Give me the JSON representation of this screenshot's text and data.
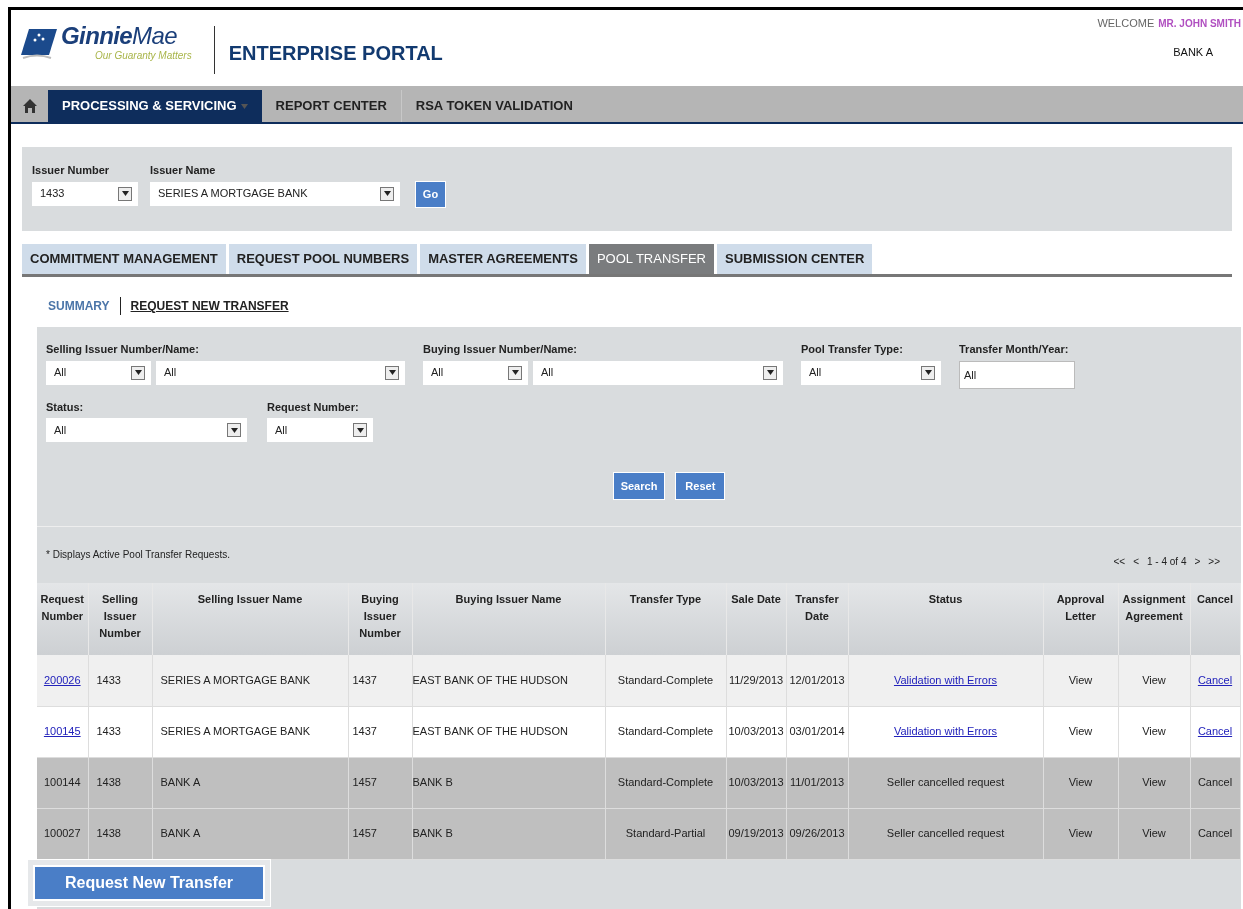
{
  "header": {
    "logo": {
      "name": "**Ginnie**Mae",
      "tagline": "Our Guaranty Matters"
    },
    "title": "ENTERPRISE PORTAL",
    "welcome": "WELCOME",
    "user": "MR. JOHN SMITH",
    "bank": "BANK A"
  },
  "nav": [
    {
      "label": "PROCESSING & SERVICING",
      "selected": true,
      "dropdown": true
    },
    {
      "label": "REPORT CENTER",
      "selected": false,
      "dropdown": false
    },
    {
      "label": "RSA TOKEN VALIDATION",
      "selected": false,
      "dropdown": false
    }
  ],
  "issuer": {
    "number_label": "Issuer Number",
    "number": "1433",
    "name_label": "Issuer Name",
    "name": "SERIES A MORTGAGE BANK",
    "go": "Go"
  },
  "tabs": [
    {
      "label": "COMMITMENT MANAGEMENT",
      "selected": false
    },
    {
      "label": "REQUEST POOL NUMBERS",
      "selected": false
    },
    {
      "label": "MASTER AGREEMENTS",
      "selected": false
    },
    {
      "label": "POOL TRANSFER",
      "selected": true
    },
    {
      "label": "SUBMISSION CENTER",
      "selected": false
    }
  ],
  "subtabs": [
    {
      "label": "SUMMARY",
      "selected": true
    },
    {
      "label": "REQUEST NEW TRANSFER",
      "selected": false
    }
  ],
  "filters": {
    "selling_label": "Selling Issuer Number/Name:",
    "selling_number": "All",
    "selling_name": "All",
    "buying_label": "Buying Issuer Number/Name:",
    "buying_number": "All",
    "buying_name": "All",
    "type_label": "Pool Transfer Type:",
    "type": "All",
    "month_label": "Transfer Month/Year:",
    "month": "All",
    "status_label": "Status:",
    "status": "All",
    "request_label": "Request Number:",
    "request": "All",
    "search": "Search",
    "reset": "Reset"
  },
  "note": "* Displays Active Pool Transfer Requests.",
  "pager": {
    "first": "<<",
    "prev": "<",
    "range": "1 - 4 of 4",
    "next": ">",
    "last": ">>"
  },
  "table": {
    "columns": [
      "Request Number",
      "Selling Issuer Number",
      "Selling Issuer Name",
      "Buying Issuer Number",
      "Buying Issuer Name",
      "Transfer Type",
      "Sale Date",
      "Transfer Date",
      "Status",
      "Approval Letter",
      "Assignment Agreement",
      "Cancel"
    ],
    "rows": [
      {
        "cancelled": false,
        "cells": [
          "200026",
          "1433",
          "SERIES A MORTGAGE BANK",
          "1437",
          "EAST BANK OF THE HUDSON",
          "Standard-Complete",
          "11/29/2013",
          "12/01/2013",
          "Validation with Errors",
          "View",
          "View",
          "Cancel"
        ]
      },
      {
        "cancelled": false,
        "cells": [
          "100145",
          "1433",
          "SERIES A MORTGAGE BANK",
          "1437",
          "EAST BANK OF THE HUDSON",
          "Standard-Complete",
          "10/03/2013",
          "03/01/2014",
          "Validation with Errors",
          "View",
          "View",
          "Cancel"
        ]
      },
      {
        "cancelled": true,
        "cells": [
          "100144",
          "1438",
          "BANK A",
          "1457",
          "BANK B",
          "Standard-Complete",
          "10/03/2013",
          "11/01/2013",
          "Seller cancelled request",
          "View",
          "View",
          "Cancel"
        ]
      },
      {
        "cancelled": true,
        "cells": [
          "100027",
          "1438",
          "BANK A",
          "1457",
          "BANK B",
          "Standard-Partial",
          "09/19/2013",
          "09/26/2013",
          "Seller cancelled request",
          "View",
          "View",
          "Cancel"
        ]
      }
    ]
  },
  "request_button": "Request New Transfer"
}
